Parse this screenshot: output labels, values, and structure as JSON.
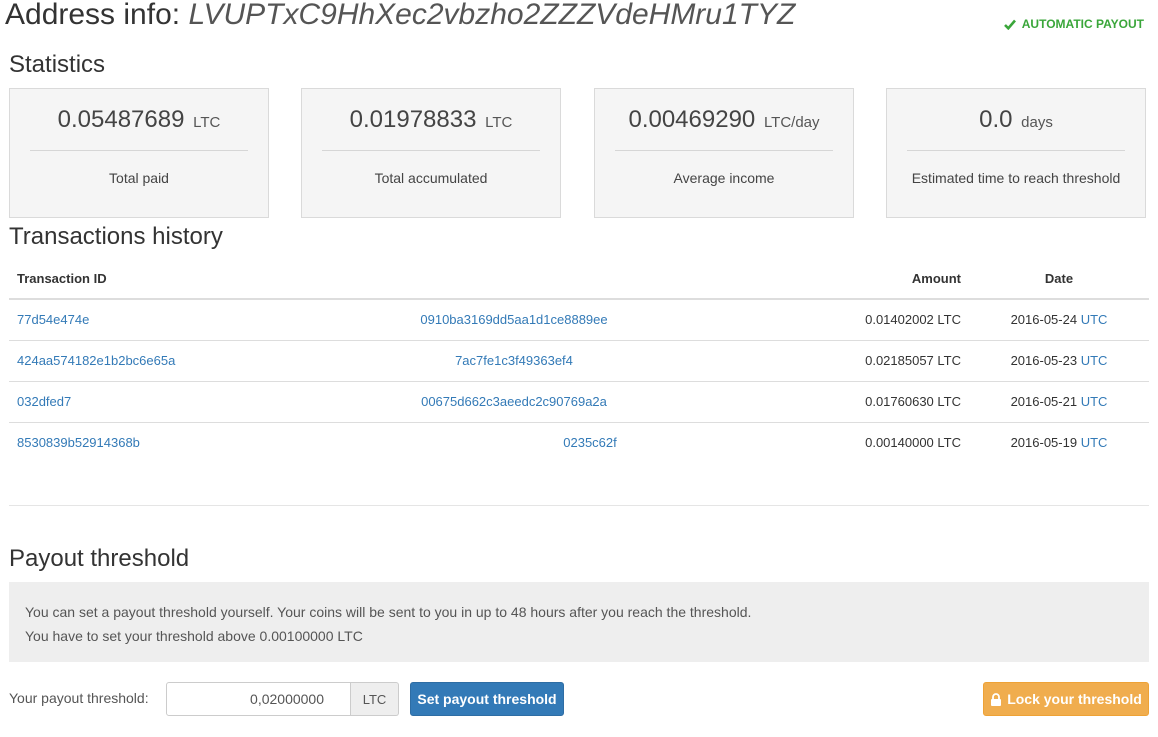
{
  "header": {
    "title": "Address info:",
    "address": "LVUPTxC9HhXec2vbzho2ZZZVdeHMru1TYZ",
    "auto_payout": "AUTOMATIC PAYOUT",
    "check_icon": "check-icon"
  },
  "statistics": {
    "title": "Statistics",
    "boxes": [
      {
        "value": "0.05487689",
        "unit": "LTC",
        "label": "Total paid"
      },
      {
        "value": "0.01978833",
        "unit": "LTC",
        "label": "Total accumulated"
      },
      {
        "value": "0.00469290",
        "unit": "LTC/day",
        "label": "Average income"
      },
      {
        "value": "0.0",
        "unit": "days",
        "label": "Estimated time to reach threshold"
      }
    ]
  },
  "transactions": {
    "title": "Transactions history",
    "columns": {
      "id": "Transaction ID",
      "amount": "Amount",
      "date": "Date"
    },
    "rows": [
      {
        "id": "77d54e474e",
        "hash": "0910ba3169dd5aa1d1ce8889ee",
        "amount": "0.01402002 LTC",
        "date": "2016-05-24",
        "tz": "UTC"
      },
      {
        "id": "424aa574182e1b2bc6e65a",
        "hash": "7ac7fe1c3f49363ef4",
        "amount": "0.02185057 LTC",
        "date": "2016-05-23",
        "tz": "UTC"
      },
      {
        "id": "032dfed7",
        "hash": "00675d662c3aeedc2c90769a2a",
        "amount": "0.01760630 LTC",
        "date": "2016-05-21",
        "tz": "UTC"
      },
      {
        "id": "8530839b52914368b",
        "hash": "0235c62f",
        "amount": "0.00140000 LTC",
        "date": "2016-05-19",
        "tz": "UTC"
      }
    ]
  },
  "payout": {
    "title": "Payout threshold",
    "info_line1": "You can set a payout threshold yourself. Your coins will be sent to you in up to 48 hours after you reach the threshold.",
    "info_line2": "You have to set your threshold above 0.00100000 LTC",
    "label": "Your payout threshold:",
    "value": "0,02000000",
    "unit": "LTC",
    "set_button": "Set payout threshold",
    "lock_button": "Lock your threshold",
    "lock_icon": "lock-icon"
  }
}
